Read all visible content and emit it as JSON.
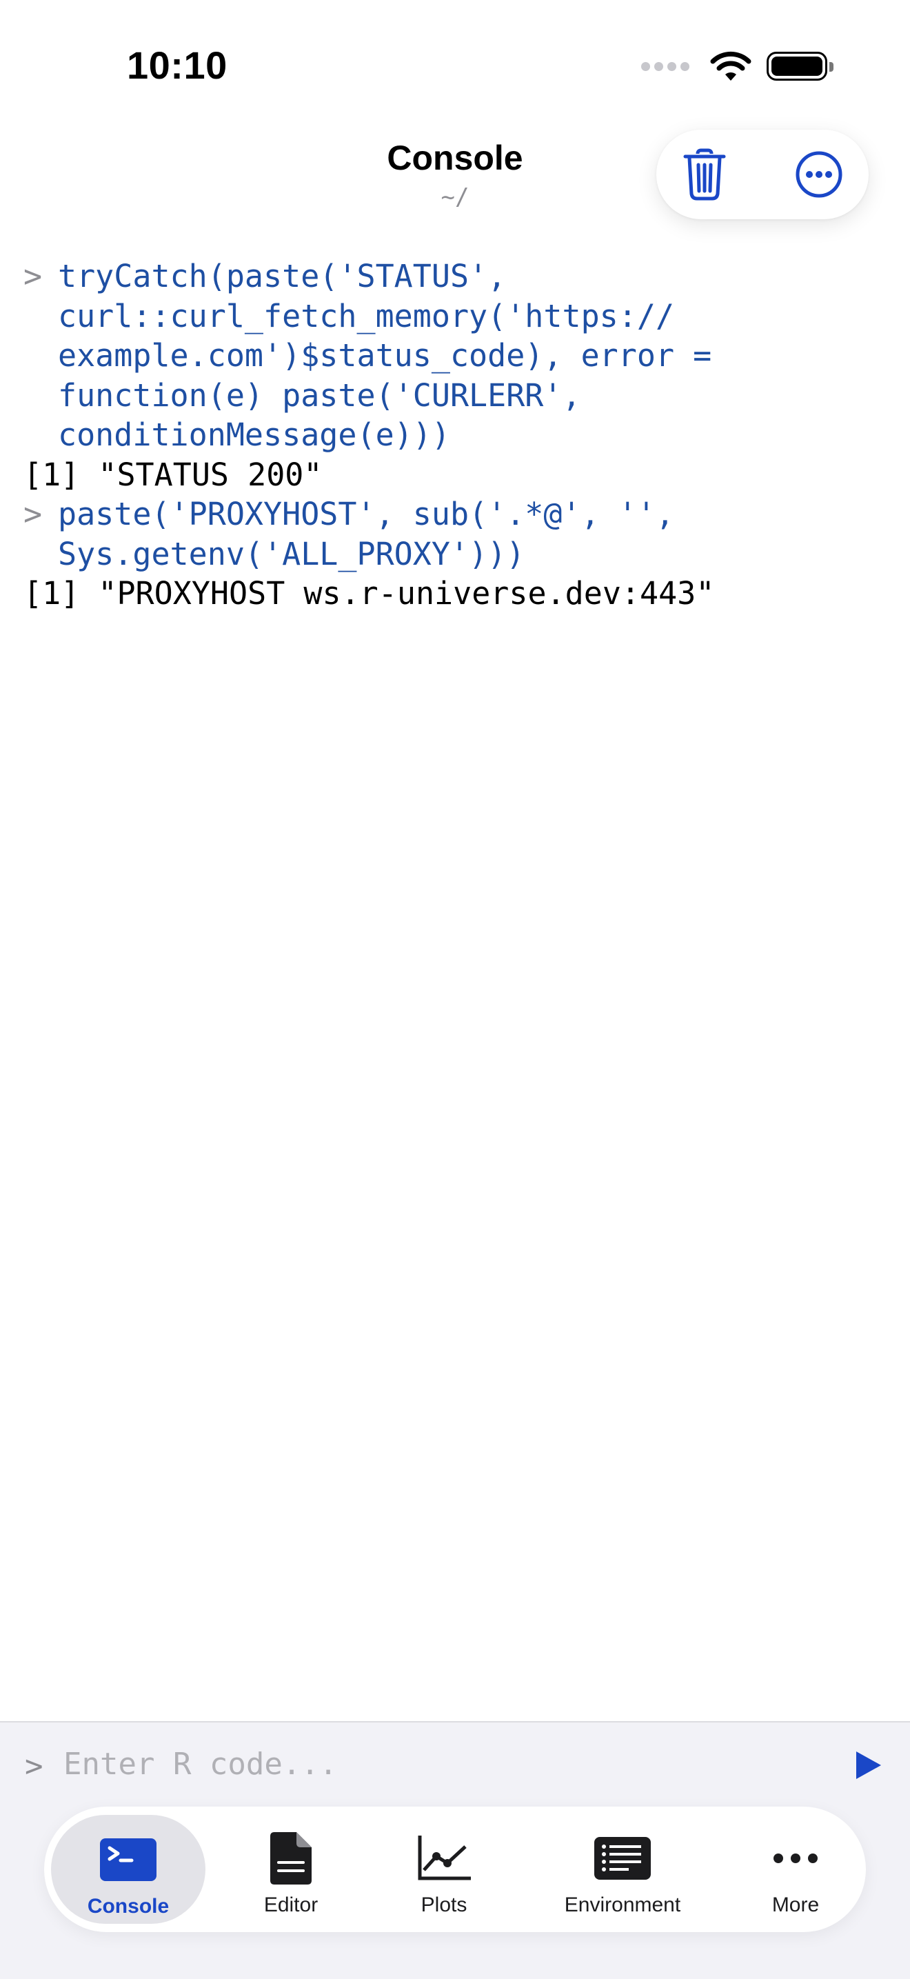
{
  "status_bar": {
    "time": "10:10"
  },
  "header": {
    "title": "Console",
    "subtitle": "~/"
  },
  "toolbar": {
    "trash_icon": "trash-icon",
    "more_icon": "ellipsis-circle-icon"
  },
  "console": {
    "entries": [
      {
        "prompt": ">",
        "command": "tryCatch(paste('STATUS',\ncurl::curl_fetch_memory('https://\nexample.com')$status_code), error =\nfunction(e) paste('CURLERR',\nconditionMessage(e)))",
        "output": "[1] \"STATUS 200\""
      },
      {
        "prompt": ">",
        "command": "paste('PROXYHOST', sub('.*@', '',\nSys.getenv('ALL_PROXY')))",
        "output": "[1] \"PROXYHOST ws.r-universe.dev:443\""
      }
    ]
  },
  "input": {
    "prompt": ">",
    "placeholder": "Enter R code...",
    "value": ""
  },
  "tabs": [
    {
      "label": "Console",
      "icon": "terminal-icon",
      "selected": true
    },
    {
      "label": "Editor",
      "icon": "document-icon",
      "selected": false
    },
    {
      "label": "Plots",
      "icon": "line-chart-icon",
      "selected": false
    },
    {
      "label": "Environment",
      "icon": "list-icon",
      "selected": false
    },
    {
      "label": "More",
      "icon": "ellipsis-icon",
      "selected": false
    }
  ],
  "colors": {
    "accent": "#1a47c7",
    "command_text": "#1e4fa3",
    "prompt": "#8e8e93",
    "input_background": "#f2f2f7"
  }
}
